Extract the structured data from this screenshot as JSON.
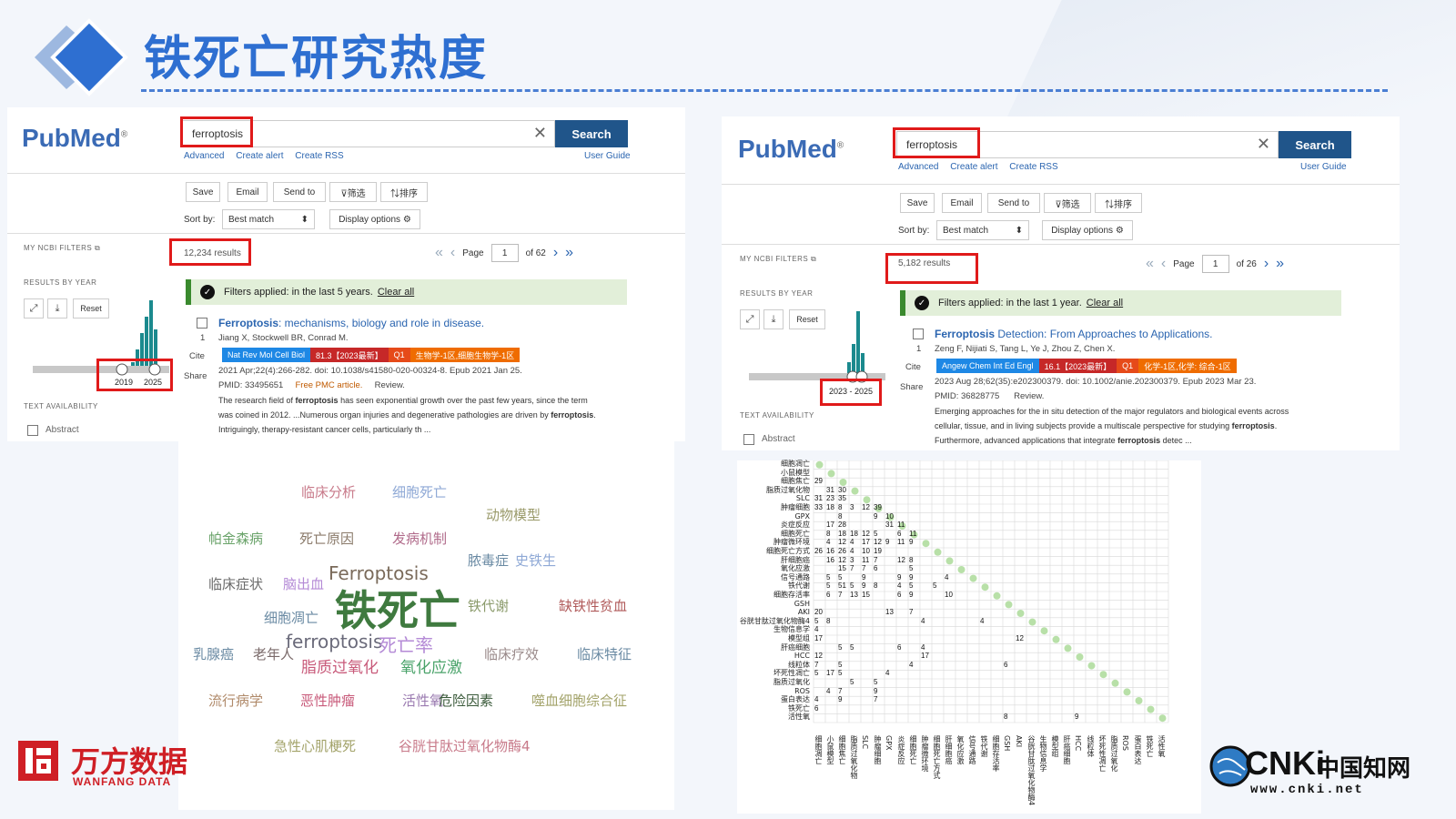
{
  "page": {
    "title": "铁死亡研究热度"
  },
  "colors": {
    "title_blue": "#2e6fd1",
    "pubmed_blue": "#3b6bb5",
    "search_button": "#20558a",
    "highlight_red": "#e01a1a",
    "filter_green": "#e2efd9"
  },
  "left_panel": {
    "logo": {
      "pub": "Pub",
      "med": "Med",
      "reg": "®"
    },
    "search": {
      "term": "ferroptosis",
      "button": "Search"
    },
    "links": [
      "Advanced",
      "Create alert",
      "Create RSS"
    ],
    "user_guide": "User Guide",
    "toolbar": [
      "Save",
      "Email",
      "Send to",
      "⊽筛选",
      "⇅排序"
    ],
    "sort_label": "Sort by:",
    "sort_value": "Best match",
    "display_options": "Display options",
    "my_ncbi_filters": "MY NCBI FILTERS",
    "results_by_year": "RESULTS BY YEAR",
    "reset": "Reset",
    "year_from": "2019",
    "year_to": "2025",
    "text_availability": "TEXT AVAILABILITY",
    "abstract": "Abstract",
    "results_count": "12,234 results",
    "pager": {
      "label": "Page",
      "current": "1",
      "of": "of 62"
    },
    "filter_text": "Filters applied: in the last 5 years.",
    "clear_all": "Clear all",
    "article": {
      "title_bold": "Ferroptosis",
      "title_rest": ": mechanisms, biology and role in disease.",
      "authors": "Jiang X, Stockwell BR, Conrad M.",
      "num": "1",
      "cite": "Cite",
      "share": "Share",
      "tags": [
        {
          "text": "Nat Rev Mol Cell Biol",
          "color": "#1e88e5"
        },
        {
          "text": "81.3【2023最新】",
          "color": "#c62828"
        },
        {
          "text": "Q1",
          "color": "#e64a19"
        },
        {
          "text": "生物学-1区,细胞生物学-1区",
          "color": "#ef6c00"
        }
      ],
      "citation": "2021 Apr;22(4):266-282. doi: 10.1038/s41580-020-00324-8. Epub 2021 Jan 25.",
      "pmid": "PMID: 33495651",
      "free": "Free PMC article.",
      "review": "Review.",
      "snippet1_a": "The research field of ",
      "snippet1_b": "ferroptosis",
      "snippet1_c": " has seen exponential growth over the past few years, since the term",
      "snippet2_a": "was coined in 2012. ...Numerous organ injuries and degenerative pathologies are driven by ",
      "snippet2_b": "ferroptosis",
      "snippet2_c": ".",
      "snippet3": "Intriguingly, therapy-resistant cancer cells, particularly th ..."
    }
  },
  "right_panel": {
    "logo": {
      "pub": "Pub",
      "med": "Med",
      "reg": "®"
    },
    "search": {
      "term": "ferroptosis",
      "button": "Search"
    },
    "links": [
      "Advanced",
      "Create alert",
      "Create RSS"
    ],
    "user_guide": "User Guide",
    "toolbar": [
      "Save",
      "Email",
      "Send to",
      "⊽筛选",
      "⇅排序"
    ],
    "sort_label": "Sort by:",
    "sort_value": "Best match",
    "display_options": "Display options",
    "my_ncbi_filters": "MY NCBI FILTERS",
    "results_by_year": "RESULTS BY YEAR",
    "reset": "Reset",
    "year_range": "2023 - 2025",
    "text_availability": "TEXT AVAILABILITY",
    "abstract": "Abstract",
    "results_count": "5,182 results",
    "pager": {
      "label": "Page",
      "current": "1",
      "of": "of 26"
    },
    "filter_text": "Filters applied: in the last 1 year.",
    "clear_all": "Clear all",
    "article": {
      "title_bold": "Ferroptosis",
      "title_rest": " Detection: From Approaches to Applications.",
      "authors": "Zeng F, Nijiati S, Tang L, Ye J, Zhou Z, Chen X.",
      "num": "1",
      "cite": "Cite",
      "share": "Share",
      "tags": [
        {
          "text": "Angew Chem Int Ed Engl",
          "color": "#1e88e5"
        },
        {
          "text": "16.1【2023最新】",
          "color": "#c62828"
        },
        {
          "text": "Q1",
          "color": "#e64a19"
        },
        {
          "text": "化学-1区,化学: 综合-1区",
          "color": "#ef6c00"
        }
      ],
      "citation": "2023 Aug 28;62(35):e202300379. doi: 10.1002/anie.202300379. Epub 2023 Mar 23.",
      "pmid": "PMID: 36828775",
      "review": "Review.",
      "snippet1": "Emerging approaches for the in situ detection of the major regulators and biological events across",
      "snippet2_a": "cellular, tissue, and in living subjects provide a multiscale perspective for studying ",
      "snippet2_b": "ferroptosis",
      "snippet2_c": ".",
      "snippet3_a": "Furthermore, advanced applications that integrate ",
      "snippet3_b": "ferroptosis",
      "snippet3_c": " detec ..."
    }
  },
  "word_cloud": [
    {
      "text": "临床分析",
      "color": "#c87a8a",
      "size": 15
    },
    {
      "text": "细胞死亡",
      "color": "#8fa9d6",
      "size": 15
    },
    {
      "text": "动物模型",
      "color": "#9a9a6a",
      "size": 15
    },
    {
      "text": "帕金森病",
      "color": "#6aa36a",
      "size": 15
    },
    {
      "text": "死亡原因",
      "color": "#8a7a6a",
      "size": 15
    },
    {
      "text": "发病机制",
      "color": "#b06a8a",
      "size": 15
    },
    {
      "text": "脓毒症",
      "color": "#6a8aa3",
      "size": 15
    },
    {
      "text": "史铁生",
      "color": "#8fa9d6",
      "size": 15
    },
    {
      "text": "临床症状",
      "color": "#6a6a6a",
      "size": 15
    },
    {
      "text": "脑出血",
      "color": "#b48ad6",
      "size": 15
    },
    {
      "text": "Ferroptosis",
      "color": "#7a6a5a",
      "size": 20
    },
    {
      "text": "铁死亡",
      "color": "#3f7a3f",
      "size": 46
    },
    {
      "text": "铁代谢",
      "color": "#8a9a6a",
      "size": 15
    },
    {
      "text": "缺铁性贫血",
      "color": "#b05a5a",
      "size": 15
    },
    {
      "text": "细胞凋亡",
      "color": "#6a8aa3",
      "size": 15
    },
    {
      "text": "乳腺癌",
      "color": "#6a8aa3",
      "size": 15
    },
    {
      "text": "老年人",
      "color": "#7a6a6a",
      "size": 15
    },
    {
      "text": "ferroptosis",
      "color": "#6a6a7a",
      "size": 20
    },
    {
      "text": "死亡率",
      "color": "#b48ad6",
      "size": 20
    },
    {
      "text": "临床疗效",
      "color": "#9a8a8a",
      "size": 15
    },
    {
      "text": "临床特征",
      "color": "#6a8aa3",
      "size": 15
    },
    {
      "text": "脂质过氧化",
      "color": "#c85a7a",
      "size": 17
    },
    {
      "text": "氧化应激",
      "color": "#4aa36a",
      "size": 17
    },
    {
      "text": "流行病学",
      "color": "#b08a6a",
      "size": 15
    },
    {
      "text": "恶性肿瘤",
      "color": "#c85a7a",
      "size": 15
    },
    {
      "text": "活性氧",
      "color": "#9a7ab0",
      "size": 15
    },
    {
      "text": "危险因素",
      "color": "#3a5a3a",
      "size": 15
    },
    {
      "text": "噬血细胞综合征",
      "color": "#a3a36a",
      "size": 15
    },
    {
      "text": "急性心肌梗死",
      "color": "#a3a36a",
      "size": 15
    },
    {
      "text": "谷胱甘肽过氧化物酶4",
      "color": "#c87a8a",
      "size": 15
    }
  ],
  "heatmap": {
    "labels": [
      "细胞凋亡",
      "小鼠模型",
      "细胞焦亡",
      "脂质过氧化物",
      "SLC",
      "肿瘤细胞",
      "GPX",
      "炎症反应",
      "细胞死亡",
      "肿瘤微环境",
      "细胞死亡方式",
      "肝细胞癌",
      "氧化应激",
      "信号通路",
      "铁代谢",
      "细胞存活率",
      "GSH",
      "AKI",
      "谷胱甘肽过氧化物酶4",
      "生物信息学",
      "模型组",
      "肝癌细胞",
      "HCC",
      "线粒体",
      "坏死性凋亡",
      "脂质过氧化",
      "ROS",
      "蛋白表达",
      "铁死亡",
      "活性氧"
    ],
    "values": [
      {
        "r": 2,
        "c": 0,
        "t": "29"
      },
      {
        "r": 3,
        "c": 1,
        "t": "31"
      },
      {
        "r": 3,
        "c": 2,
        "t": "30"
      },
      {
        "r": 4,
        "c": 0,
        "t": "31"
      },
      {
        "r": 4,
        "c": 1,
        "t": "23"
      },
      {
        "r": 4,
        "c": 2,
        "t": "35"
      },
      {
        "r": 5,
        "c": 0,
        "t": "33"
      },
      {
        "r": 5,
        "c": 1,
        "t": "18"
      },
      {
        "r": 5,
        "c": 2,
        "t": "8"
      },
      {
        "r": 5,
        "c": 3,
        "t": "3"
      },
      {
        "r": 5,
        "c": 4,
        "t": "12"
      },
      {
        "r": 5,
        "c": 5,
        "t": "39"
      },
      {
        "r": 6,
        "c": 2,
        "t": "8"
      },
      {
        "r": 6,
        "c": 5,
        "t": "9"
      },
      {
        "r": 6,
        "c": 6,
        "t": "10"
      },
      {
        "r": 7,
        "c": 1,
        "t": "17"
      },
      {
        "r": 7,
        "c": 2,
        "t": "28"
      },
      {
        "r": 7,
        "c": 6,
        "t": "31"
      },
      {
        "r": 7,
        "c": 7,
        "t": "11"
      },
      {
        "r": 8,
        "c": 1,
        "t": "8"
      },
      {
        "r": 8,
        "c": 2,
        "t": "18"
      },
      {
        "r": 8,
        "c": 3,
        "t": "18"
      },
      {
        "r": 8,
        "c": 4,
        "t": "12"
      },
      {
        "r": 8,
        "c": 5,
        "t": "5"
      },
      {
        "r": 8,
        "c": 7,
        "t": "6"
      },
      {
        "r": 8,
        "c": 8,
        "t": "11"
      },
      {
        "r": 9,
        "c": 1,
        "t": "4"
      },
      {
        "r": 9,
        "c": 2,
        "t": "12"
      },
      {
        "r": 9,
        "c": 3,
        "t": "4"
      },
      {
        "r": 9,
        "c": 4,
        "t": "17"
      },
      {
        "r": 9,
        "c": 5,
        "t": "12"
      },
      {
        "r": 9,
        "c": 6,
        "t": "9"
      },
      {
        "r": 9,
        "c": 7,
        "t": "11"
      },
      {
        "r": 9,
        "c": 8,
        "t": "9"
      },
      {
        "r": 10,
        "c": 0,
        "t": "26"
      },
      {
        "r": 10,
        "c": 1,
        "t": "16"
      },
      {
        "r": 10,
        "c": 2,
        "t": "26"
      },
      {
        "r": 10,
        "c": 3,
        "t": "4"
      },
      {
        "r": 10,
        "c": 4,
        "t": "10"
      },
      {
        "r": 10,
        "c": 5,
        "t": "19"
      },
      {
        "r": 11,
        "c": 1,
        "t": "16"
      },
      {
        "r": 11,
        "c": 2,
        "t": "12"
      },
      {
        "r": 11,
        "c": 3,
        "t": "3"
      },
      {
        "r": 11,
        "c": 4,
        "t": "11"
      },
      {
        "r": 11,
        "c": 5,
        "t": "7"
      },
      {
        "r": 11,
        "c": 7,
        "t": "12"
      },
      {
        "r": 11,
        "c": 8,
        "t": "8"
      },
      {
        "r": 12,
        "c": 2,
        "t": "15"
      },
      {
        "r": 12,
        "c": 3,
        "t": "7"
      },
      {
        "r": 12,
        "c": 4,
        "t": "7"
      },
      {
        "r": 12,
        "c": 5,
        "t": "6"
      },
      {
        "r": 12,
        "c": 8,
        "t": "5"
      },
      {
        "r": 13,
        "c": 1,
        "t": "5"
      },
      {
        "r": 13,
        "c": 2,
        "t": "5"
      },
      {
        "r": 13,
        "c": 4,
        "t": "9"
      },
      {
        "r": 13,
        "c": 7,
        "t": "9"
      },
      {
        "r": 13,
        "c": 8,
        "t": "9"
      },
      {
        "r": 13,
        "c": 11,
        "t": "4"
      },
      {
        "r": 14,
        "c": 1,
        "t": "5"
      },
      {
        "r": 14,
        "c": 2,
        "t": "51"
      },
      {
        "r": 14,
        "c": 3,
        "t": "5"
      },
      {
        "r": 14,
        "c": 4,
        "t": "9"
      },
      {
        "r": 14,
        "c": 5,
        "t": "8"
      },
      {
        "r": 14,
        "c": 7,
        "t": "4"
      },
      {
        "r": 14,
        "c": 8,
        "t": "5"
      },
      {
        "r": 14,
        "c": 10,
        "t": "5"
      },
      {
        "r": 15,
        "c": 1,
        "t": "6"
      },
      {
        "r": 15,
        "c": 2,
        "t": "7"
      },
      {
        "r": 15,
        "c": 3,
        "t": "13"
      },
      {
        "r": 15,
        "c": 4,
        "t": "15"
      },
      {
        "r": 15,
        "c": 7,
        "t": "6"
      },
      {
        "r": 15,
        "c": 8,
        "t": "9"
      },
      {
        "r": 15,
        "c": 11,
        "t": "10"
      },
      {
        "r": 17,
        "c": 0,
        "t": "20"
      },
      {
        "r": 17,
        "c": 6,
        "t": "13"
      },
      {
        "r": 17,
        "c": 8,
        "t": "7"
      },
      {
        "r": 18,
        "c": 0,
        "t": "5"
      },
      {
        "r": 18,
        "c": 1,
        "t": "8"
      },
      {
        "r": 18,
        "c": 9,
        "t": "4"
      },
      {
        "r": 18,
        "c": 14,
        "t": "4"
      },
      {
        "r": 19,
        "c": 0,
        "t": "4"
      },
      {
        "r": 20,
        "c": 0,
        "t": "17"
      },
      {
        "r": 20,
        "c": 17,
        "t": "12"
      },
      {
        "r": 21,
        "c": 2,
        "t": "5"
      },
      {
        "r": 21,
        "c": 3,
        "t": "5"
      },
      {
        "r": 21,
        "c": 7,
        "t": "6"
      },
      {
        "r": 21,
        "c": 9,
        "t": "4"
      },
      {
        "r": 22,
        "c": 0,
        "t": "12"
      },
      {
        "r": 22,
        "c": 9,
        "t": "17"
      },
      {
        "r": 23,
        "c": 0,
        "t": "7"
      },
      {
        "r": 23,
        "c": 2,
        "t": "5"
      },
      {
        "r": 23,
        "c": 8,
        "t": "4"
      },
      {
        "r": 23,
        "c": 16,
        "t": "6"
      },
      {
        "r": 24,
        "c": 0,
        "t": "5"
      },
      {
        "r": 24,
        "c": 1,
        "t": "17"
      },
      {
        "r": 24,
        "c": 2,
        "t": "5"
      },
      {
        "r": 24,
        "c": 6,
        "t": "4"
      },
      {
        "r": 25,
        "c": 3,
        "t": "5"
      },
      {
        "r": 25,
        "c": 5,
        "t": "5"
      },
      {
        "r": 26,
        "c": 1,
        "t": "4"
      },
      {
        "r": 26,
        "c": 2,
        "t": "7"
      },
      {
        "r": 26,
        "c": 5,
        "t": "9"
      },
      {
        "r": 27,
        "c": 0,
        "t": "4"
      },
      {
        "r": 27,
        "c": 2,
        "t": "9"
      },
      {
        "r": 27,
        "c": 5,
        "t": "7"
      },
      {
        "r": 28,
        "c": 0,
        "t": "6"
      },
      {
        "r": 29,
        "c": 16,
        "t": "8"
      },
      {
        "r": 29,
        "c": 22,
        "t": "9"
      }
    ]
  },
  "bottom_logos": {
    "wanfang_cn": "万方数据",
    "wanfang_en": "WANFANG DATA",
    "cnki_main": "CNKi",
    "cnki_cn": "中国知网",
    "cnki_url": "www.cnki.net"
  }
}
